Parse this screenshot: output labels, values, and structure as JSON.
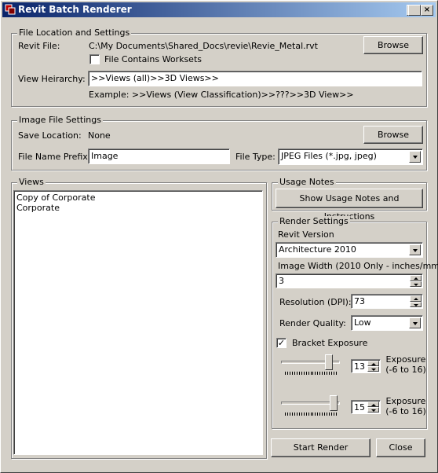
{
  "window": {
    "title": "Revit Batch Renderer",
    "min": "_",
    "max": "□",
    "close": "×"
  },
  "file_location": {
    "group_label": "File Location and Settings",
    "revit_file_label": "Revit File:",
    "revit_file_path": "C:\\My Documents\\Shared_Docs\\revie\\Revie_Metal.rvt",
    "browse_label": "Browse",
    "worksets_label": "File Contains Worksets",
    "worksets_checked": "",
    "view_hierarchy_label": "View Heirarchy:",
    "view_hierarchy_value": ">>Views (all)>>3D Views>>",
    "example_text": "Example:  >>Views (View Classification)>>???>>3D View>>"
  },
  "image_file": {
    "group_label": "Image File Settings",
    "save_location_label": "Save Location:",
    "save_location_value": "None",
    "browse_label": "Browse",
    "prefix_label": "File Name Prefix:",
    "prefix_value": "Image",
    "file_type_label": "File Type:",
    "file_type_value": "JPEG Files (*.jpg, jpeg)"
  },
  "views": {
    "group_label": "Views",
    "items": [
      "Copy of Corporate",
      "Corporate"
    ]
  },
  "usage_notes": {
    "group_label": "Usage Notes",
    "button_label": "Show Usage Notes and Instructions"
  },
  "render_settings": {
    "group_label": "Render Settings",
    "revit_version_label": "Revit Version",
    "revit_version_value": "Architecture 2010",
    "image_width_label": "Image Width (2010 Only - inches/mm)",
    "image_width_value": "3",
    "resolution_label": "Resolution (DPI):",
    "resolution_value": "73",
    "quality_label": "Render Quality:",
    "quality_value": "Low",
    "bracket_label": "Bracket Exposure",
    "bracket_checked": "✓",
    "exposure1_value": "13",
    "exposure1_level": 13,
    "exposure2_value": "15",
    "exposure2_level": 15,
    "exposure_label": "Exposure",
    "exposure_range": "(-6 to 16)"
  },
  "actions": {
    "start_label": "Start Render",
    "close_label": "Close"
  }
}
